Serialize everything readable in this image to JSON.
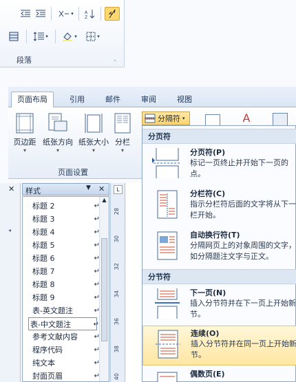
{
  "paragraph_group": {
    "label": "段落"
  },
  "tabs": [
    {
      "label": "页面布局"
    },
    {
      "label": "引用"
    },
    {
      "label": "邮件"
    },
    {
      "label": "审阅"
    },
    {
      "label": "视图"
    }
  ],
  "ribbon": {
    "margins": "页边距",
    "orientation": "纸张方向",
    "size": "纸张大小",
    "columns": "分栏",
    "breaks": "分隔符",
    "group_label": "页面设置"
  },
  "styles_pane": {
    "title": "样式",
    "items": [
      "标题 2",
      "标题 3",
      "标题 4",
      "标题 5",
      "标题 6",
      "标题 7",
      "标题 8",
      "标题 9",
      "表-英文题注",
      "表-中文题注",
      "参考文献内容",
      "程序代码",
      "纯文本",
      "封面页眉"
    ],
    "selected": "表-中文题注"
  },
  "ruler_numbers": [
    "28",
    "30",
    "32",
    "34",
    "36",
    "38",
    "40"
  ],
  "breaks_menu": {
    "section_page": "分页符",
    "section_section": "分节符",
    "items": [
      {
        "title": "分页符(P)",
        "desc": "标记一页终止并开始下一页的点。"
      },
      {
        "title": "分栏符(C)",
        "desc": "指示分栏符后面的文字将从下一栏开始。"
      },
      {
        "title": "自动换行符(T)",
        "desc": "分隔网页上的对象周围的文字，如分隔题注文字与正文。"
      },
      {
        "title": "下一页(N)",
        "desc": "插入分节符并在下一页上开始新节。"
      },
      {
        "title": "连续(O)",
        "desc": "插入分节符并在同一页上开始新节。"
      },
      {
        "title": "偶数页(E)",
        "desc": ""
      }
    ],
    "highlighted": "连续(O)"
  }
}
